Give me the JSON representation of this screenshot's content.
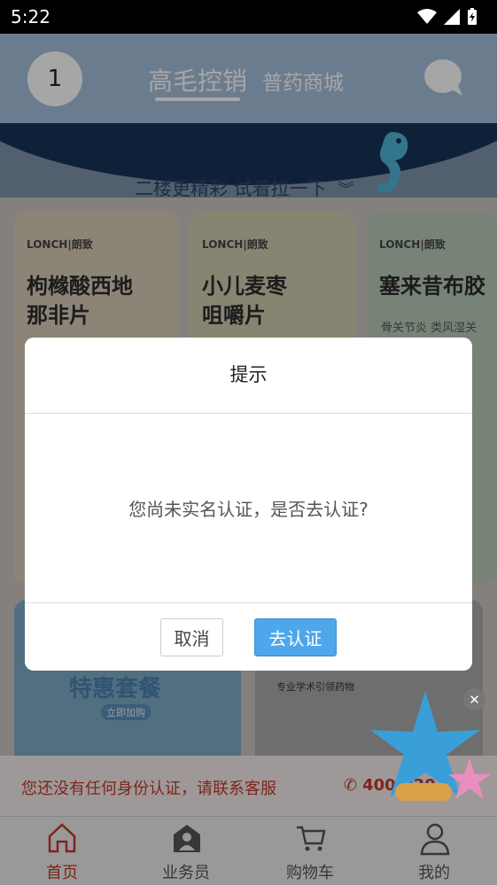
{
  "status_bar": {
    "time": "5:22"
  },
  "header": {
    "avatar_text": "1",
    "tabs": [
      {
        "label": "高毛控销",
        "active": true
      },
      {
        "label": "普药商城",
        "active": false
      }
    ]
  },
  "banner": {
    "pull_hint": "二楼更精彩 试着拉一下"
  },
  "products": [
    {
      "brand": "LONCH|朗致",
      "title_line1": "枸橼酸西地",
      "title_line2": "那非片"
    },
    {
      "brand": "LONCH|朗致",
      "title_line1": "小儿麦枣",
      "title_line2": "咀嚼片"
    },
    {
      "brand": "LONCH|朗致",
      "title_line1": "塞来昔布胶",
      "desc": "骨关节炎 类风湿关"
    }
  ],
  "promo": {
    "left_title": "特惠套餐",
    "left_sub": "立即加购",
    "right_sub": "专业学术引领药物"
  },
  "notice": {
    "text": "您还没有任何身份认证，请联系客服",
    "phone": "400-820"
  },
  "bottom_nav": [
    {
      "label": "首页",
      "icon": "home-icon",
      "active": true
    },
    {
      "label": "业务员",
      "icon": "salesperson-icon",
      "active": false
    },
    {
      "label": "购物车",
      "icon": "cart-icon",
      "active": false
    },
    {
      "label": "我的",
      "icon": "profile-icon",
      "active": false
    }
  ],
  "dialog": {
    "title": "提示",
    "message": "您尚未实名认证，是否去认证?",
    "cancel_label": "取消",
    "confirm_label": "去认证"
  },
  "colors": {
    "accent": "#4da7ea",
    "brand_red": "#c23a2a",
    "header_bg": "#a7bfdc"
  }
}
